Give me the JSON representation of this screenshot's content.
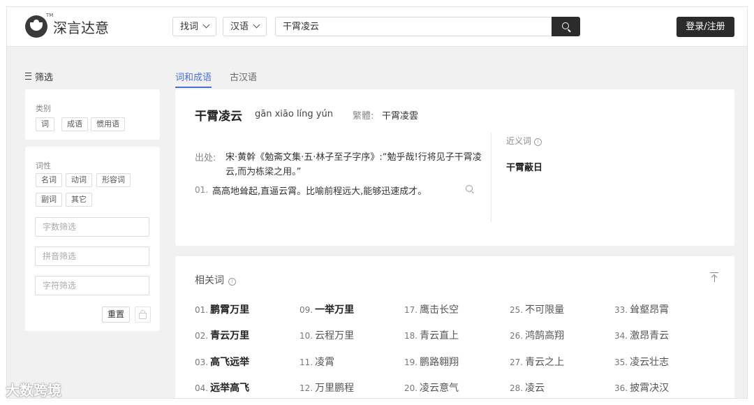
{
  "header": {
    "logo_text": "深言达意",
    "logo_tm": "TM",
    "mode_select": "找词",
    "lang_select": "汉语",
    "search_value": "干霄凌云",
    "login_label": "登录/注册"
  },
  "filters": {
    "title": "筛选",
    "category_label": "类别",
    "categories": [
      "词",
      "成语",
      "惯用语"
    ],
    "pos_label": "词性",
    "pos": [
      "名词",
      "动词",
      "形容词",
      "副词",
      "其它"
    ],
    "count_placeholder": "字数筛选",
    "pinyin_placeholder": "拼音筛选",
    "char_placeholder": "字符筛选",
    "reset_label": "重置"
  },
  "tabs": [
    "词和成语",
    "古汉语"
  ],
  "entry": {
    "word": "干霄凌云",
    "pinyin": "gān xiāo líng yún",
    "trad_label": "繁體:",
    "trad_value": "干霄凌雲",
    "source_label": "出处:",
    "source_text": "宋·黄幹《勉斋文集·五·林子至子字序》:“勉乎哉!行将见子干霄凌云,而为栋梁之用。”",
    "def_num": "01.",
    "def_text": "高高地耸起,直逼云霄。比喻前程远大,能够迅速成才。",
    "syn_label": "近义词",
    "syn_word": "干霄蔽日"
  },
  "related": {
    "title": "相关词",
    "items": [
      {
        "n": "01.",
        "t": "鹏霄万里"
      },
      {
        "n": "02.",
        "t": "青云万里"
      },
      {
        "n": "03.",
        "t": "高飞远举"
      },
      {
        "n": "04.",
        "t": "远举高飞"
      },
      {
        "n": "09.",
        "t": "一举万里"
      },
      {
        "n": "10.",
        "t": "云程万里"
      },
      {
        "n": "11.",
        "t": "凌霄"
      },
      {
        "n": "12.",
        "t": "万里鹏程"
      },
      {
        "n": "17.",
        "t": "鹰击长空"
      },
      {
        "n": "18.",
        "t": "青云直上"
      },
      {
        "n": "19.",
        "t": "鹏路翱翔"
      },
      {
        "n": "20.",
        "t": "凌云意气"
      },
      {
        "n": "25.",
        "t": "不可限量"
      },
      {
        "n": "26.",
        "t": "鸿鹄高翔"
      },
      {
        "n": "27.",
        "t": "青云之上"
      },
      {
        "n": "28.",
        "t": "凌云"
      },
      {
        "n": "33.",
        "t": "耸壑昂霄"
      },
      {
        "n": "34.",
        "t": "激昂青云"
      },
      {
        "n": "35.",
        "t": "凌云壮志"
      },
      {
        "n": "36.",
        "t": "披霄决汉"
      }
    ]
  },
  "watermark": "大数跨境"
}
